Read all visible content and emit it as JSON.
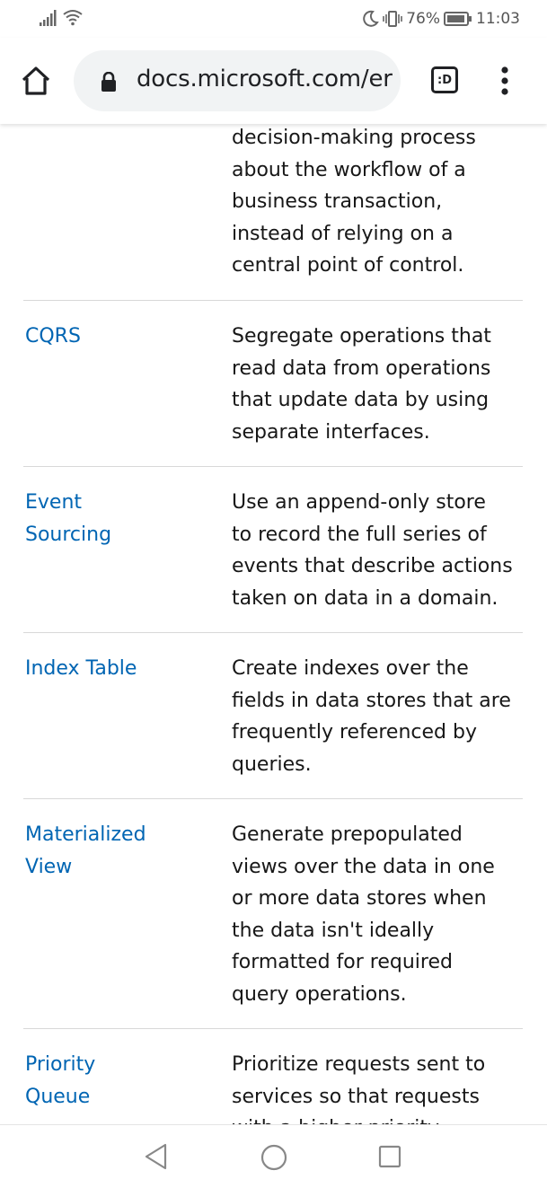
{
  "status_bar": {
    "battery_percent": "76%",
    "time": "11:03",
    "icons": [
      "signal-icon",
      "wifi-icon",
      "moon-icon",
      "vibrate-icon",
      "battery-icon"
    ]
  },
  "browser": {
    "url": "docs.microsoft.com/er",
    "tab_label": ":D",
    "icons": [
      "home-icon",
      "lock-icon",
      "tab-switcher-icon",
      "more-vert-icon"
    ]
  },
  "table": {
    "rows": [
      {
        "name_lines": [],
        "desc_lines": [
          "decision-making process",
          "about the workflow of a",
          "business transaction,",
          "instead of relying on a",
          "central point of control."
        ]
      },
      {
        "name_lines": [
          "CQRS"
        ],
        "desc_lines": [
          "Segregate operations that",
          "read data from operations",
          "that update data by using",
          "separate interfaces."
        ]
      },
      {
        "name_lines": [
          "Event",
          "Sourcing"
        ],
        "desc_lines": [
          "Use an append-only store",
          "to record the full series of",
          "events that describe actions",
          "taken on data in a domain."
        ]
      },
      {
        "name_lines": [
          "Index Table"
        ],
        "desc_lines": [
          "Create indexes over the",
          "fields in data stores that are",
          "frequently referenced by",
          "queries."
        ]
      },
      {
        "name_lines": [
          "Materialized",
          "View"
        ],
        "desc_lines": [
          "Generate prepopulated",
          "views over the data in one",
          "or more data stores when",
          "the data isn't ideally",
          "formatted for required",
          "query operations."
        ]
      },
      {
        "name_lines": [
          "Priority",
          "Queue"
        ],
        "desc_lines": [
          "Prioritize requests sent to",
          "services so that requests",
          "with a higher priority"
        ]
      }
    ]
  },
  "colors": {
    "link": "#0065b3",
    "text": "#171717",
    "divider": "#d8d8d8",
    "url_pill": "#f1f3f4"
  },
  "nav_bar": {
    "icons": [
      "back-icon",
      "home-circle-icon",
      "recent-apps-icon"
    ]
  }
}
